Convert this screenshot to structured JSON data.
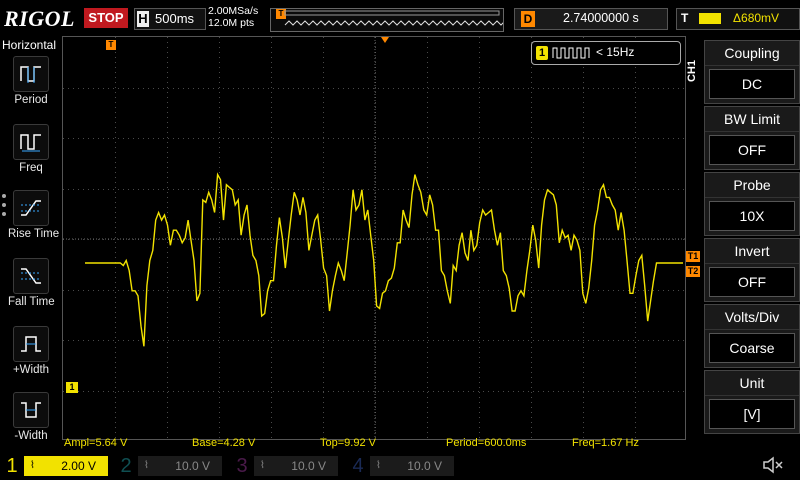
{
  "topbar": {
    "brand": "RIGOL",
    "run_state": "STOP",
    "timebase_letter": "H",
    "timebase": "500ms",
    "sample_rate": "2.00MSa/s",
    "memory_depth": "12.0M pts",
    "trigger_marker": "T",
    "delay_letter": "D",
    "delay": "2.74000000 s",
    "trigger_letter": "T",
    "trigger_level": "680mV",
    "trigger_level_prefix": "Δ"
  },
  "left_menu": {
    "title": "Horizontal",
    "items": [
      {
        "label": "Period",
        "icon": "period-icon"
      },
      {
        "label": "Freq",
        "icon": "frequency-icon"
      },
      {
        "label": "Rise Time",
        "icon": "rise-time-icon"
      },
      {
        "label": "Fall Time",
        "icon": "fall-time-icon"
      },
      {
        "label": "+Width",
        "icon": "positive-width-icon"
      },
      {
        "label": "-Width",
        "icon": "negative-width-icon"
      }
    ]
  },
  "freq_counter": {
    "channel": "1",
    "text": "< 15Hz"
  },
  "right_menu": {
    "tab": "CH1",
    "items": [
      {
        "label": "Coupling",
        "value": "DC"
      },
      {
        "label": "BW Limit",
        "value": "OFF"
      },
      {
        "label": "Probe",
        "value": "10X"
      },
      {
        "label": "Invert",
        "value": "OFF"
      },
      {
        "label": "Volts/Div",
        "value": "Coarse"
      },
      {
        "label": "Unit",
        "value": "[V]"
      }
    ]
  },
  "measurements": {
    "ampl": "Ampl=5.64 V",
    "base": "Base=4.28 V",
    "top": "Top=9.92 V",
    "period": "Period=600.0ms",
    "freq": "Freq=1.67 Hz"
  },
  "channels": [
    {
      "num": "1",
      "coupling": "⌇",
      "scale": "2.00 V"
    },
    {
      "num": "2",
      "coupling": "⌇",
      "scale": "10.0 V"
    },
    {
      "num": "3",
      "coupling": "⌇",
      "scale": "10.0 V"
    },
    {
      "num": "4",
      "coupling": "⌇",
      "scale": "10.0 V"
    }
  ],
  "markers": {
    "ch1_offset": "1",
    "trigger_t1": "T1",
    "trigger_t2": "T2"
  },
  "colors": {
    "ch1": "#f2e200",
    "trigger": "#ff8800",
    "stop": "#c0191f",
    "accent": "#39a9ff"
  },
  "waveform": {
    "samples": [
      5.5,
      5.5,
      5.5,
      5.5,
      5.5,
      5.5,
      5.5,
      5.5,
      5.5,
      5.5,
      5.5,
      5.5,
      5.5,
      5.4,
      5.6,
      5.2,
      4.4,
      4.4,
      4.2,
      3.0,
      2.2,
      4.6,
      5.6,
      6.0,
      7.2,
      7.5,
      7.2,
      7.4,
      7.0,
      6.2,
      6.8,
      6.8,
      6.6,
      6.3,
      6.5,
      7.2,
      6.4,
      5.6,
      4.0,
      4.3,
      8.0,
      7.9,
      8.3,
      8.0,
      7.5,
      9.0,
      8.8,
      7.2,
      8.6,
      8.5,
      8.4,
      7.8,
      8.0,
      6.6,
      7.4,
      7.8,
      6.6,
      5.8,
      5.6,
      5.0,
      3.4,
      3.5,
      4.4,
      4.8,
      4.8,
      6.2,
      7.3,
      6.5,
      5.3,
      6.4,
      7.4,
      8.3,
      8.0,
      7.4,
      8.1,
      7.5,
      6.0,
      6.6,
      7.2,
      7.4,
      6.4,
      5.3,
      5.0,
      3.6,
      4.4,
      5.0,
      5.5,
      5.2,
      4.8,
      5.9,
      7.0,
      8.4,
      7.6,
      7.8,
      8.4,
      7.2,
      7.6,
      6.6,
      5.6,
      3.8,
      3.7,
      4.3,
      4.4,
      4.8,
      4.9,
      5.3,
      6.3,
      6.3,
      7.6,
      7.2,
      6.9,
      8.2,
      9.0,
      8.6,
      8.3,
      7.6,
      7.4,
      8.2,
      7.8,
      6.8,
      6.8,
      5.2,
      5.0,
      4.4,
      3.9,
      5.4,
      5.2,
      6.2,
      6.7,
      5.9,
      5.6,
      6.8,
      6.0,
      6.2,
      7.1,
      7.6,
      7.4,
      7.5,
      7.6,
      6.8,
      6.2,
      6.7,
      5.2,
      5.0,
      4.5,
      3.6,
      3.6,
      4.2,
      4.4,
      4.2,
      5.2,
      6.0,
      7.0,
      6.4,
      5.3,
      7.0,
      8.0,
      8.4,
      8.3,
      8.2,
      7.8,
      6.3,
      6.8,
      6.5,
      6.6,
      6.0,
      6.6,
      6.4,
      6.0,
      4.3,
      3.9,
      4.5,
      5.6,
      7.0,
      7.6,
      8.4,
      8.6,
      8.1,
      8.1,
      7.8,
      7.6,
      6.8,
      7.5,
      6.8,
      5.6,
      4.3,
      4.3,
      5.0,
      5.6,
      5.8,
      4.6,
      3.2,
      4.0,
      4.8,
      5.5,
      5.5,
      5.5,
      5.5,
      5.5,
      5.5,
      5.5,
      5.5,
      5.5,
      5.5
    ]
  }
}
